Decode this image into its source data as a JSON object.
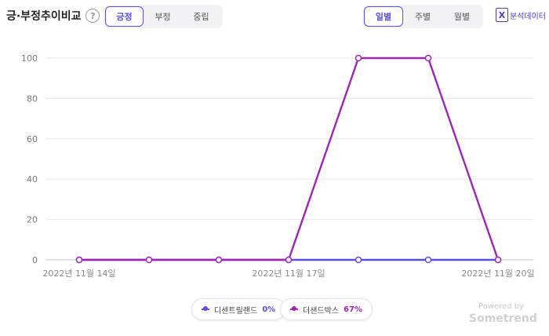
{
  "header": {
    "title": "긍·부정추이비교",
    "help_icon": "?"
  },
  "sentiment_tabs": [
    "긍정",
    "부정",
    "중립"
  ],
  "sentiment_active": 0,
  "period_tabs": [
    "일별",
    "주별",
    "월별"
  ],
  "period_active": 0,
  "export": {
    "icon": "X",
    "label": "분석데이터"
  },
  "colors": {
    "accent": "#5b4fd6",
    "series1": "#5b4fd6",
    "series2": "#9c27b0"
  },
  "chart_data": {
    "type": "line",
    "x": [
      "2022-11-14",
      "2022-11-15",
      "2022-11-16",
      "2022-11-17",
      "2022-11-18",
      "2022-11-19",
      "2022-11-20"
    ],
    "xticks": [
      "2022년 11월 14일",
      "2022년 11월 17일",
      "2022년 11월 20일"
    ],
    "xtick_index": [
      0,
      3,
      6
    ],
    "yticks": [
      0,
      20,
      40,
      60,
      80,
      100
    ],
    "ylim": [
      0,
      100
    ],
    "grid": true,
    "legend_position": "bottom-center",
    "series": [
      {
        "name": "디센트릴랜드",
        "values": [
          0,
          0,
          0,
          0,
          0,
          0,
          0
        ],
        "color": "#5b4fd6",
        "pct": "0%"
      },
      {
        "name": "더샌드박스",
        "values": [
          0,
          0,
          0,
          0,
          100,
          100,
          0
        ],
        "color": "#9c27b0",
        "pct": "67%"
      }
    ]
  },
  "footer": {
    "powered": "Powered by",
    "brand": "Sometrend"
  }
}
